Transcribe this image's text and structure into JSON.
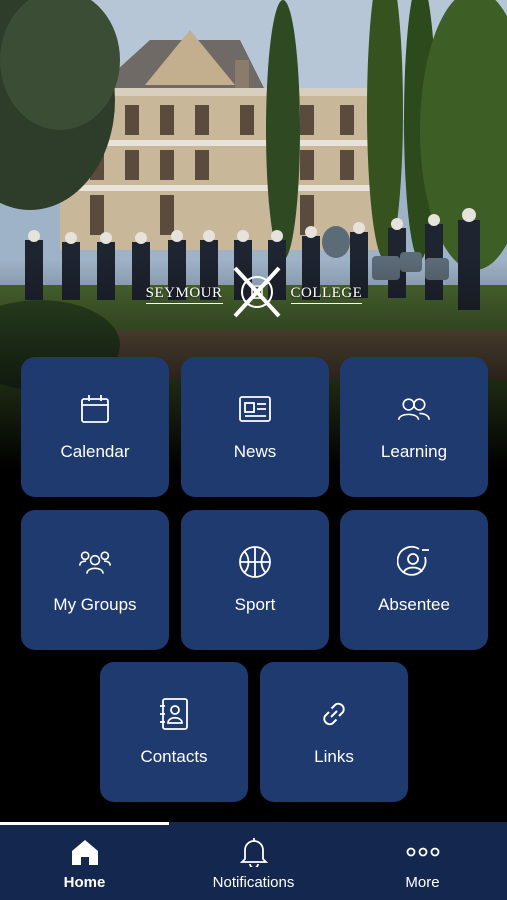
{
  "hero": {
    "brand_left": "SEYMOUR",
    "brand_right": "COLLEGE"
  },
  "tiles": [
    {
      "label": "Calendar",
      "icon": "calendar-icon"
    },
    {
      "label": "News",
      "icon": "newspaper-icon"
    },
    {
      "label": "Learning",
      "icon": "people-icon"
    },
    {
      "label": "My Groups",
      "icon": "group-icon"
    },
    {
      "label": "Sport",
      "icon": "basketball-icon"
    },
    {
      "label": "Absentee",
      "icon": "user-minus-icon"
    },
    {
      "label": "Contacts",
      "icon": "contact-book-icon"
    },
    {
      "label": "Links",
      "icon": "link-icon"
    }
  ],
  "nav": {
    "items": [
      {
        "label": "Home",
        "icon": "home-icon",
        "active": true
      },
      {
        "label": "Notifications",
        "icon": "bell-icon",
        "active": false
      },
      {
        "label": "More",
        "icon": "more-icon",
        "active": false
      }
    ]
  },
  "colors": {
    "tile": "#1f3a6e",
    "nav": "#14284f",
    "background": "#000000"
  }
}
